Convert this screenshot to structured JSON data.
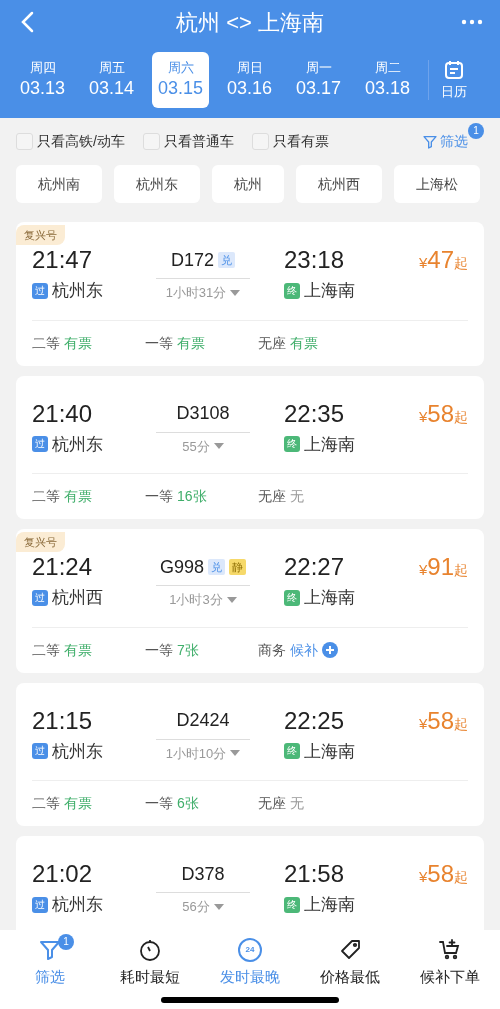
{
  "header": {
    "title": "杭州 <> 上海南"
  },
  "dates": [
    {
      "weekday": "周四",
      "date": "03.13",
      "selected": false
    },
    {
      "weekday": "周五",
      "date": "03.14",
      "selected": false
    },
    {
      "weekday": "周六",
      "date": "03.15",
      "selected": true
    },
    {
      "weekday": "周日",
      "date": "03.16",
      "selected": false
    },
    {
      "weekday": "周一",
      "date": "03.17",
      "selected": false
    },
    {
      "weekday": "周二",
      "date": "03.18",
      "selected": false
    }
  ],
  "calendar_label": "日历",
  "filters": [
    {
      "label": "只看高铁/动车",
      "checked": false
    },
    {
      "label": "只看普通车",
      "checked": false
    },
    {
      "label": "只看有票",
      "checked": false
    }
  ],
  "filter_button": {
    "label": "筛选",
    "badge": "1"
  },
  "stations": [
    "杭州南",
    "杭州东",
    "杭州",
    "杭州西",
    "上海松"
  ],
  "trains": [
    {
      "badge": "复兴号",
      "depart": "21:47",
      "train": "D172",
      "tags": [
        {
          "text": "兑",
          "kind": "blue"
        }
      ],
      "duration": "1小时31分",
      "arrive": "23:18",
      "from_tag": "过",
      "from": "杭州东",
      "to_tag": "终",
      "to": "上海南",
      "price_symbol": "¥",
      "price": "47",
      "price_suffix": "起",
      "seats": [
        {
          "class": "二等",
          "status": "有票",
          "kind": "available"
        },
        {
          "class": "一等",
          "status": "有票",
          "kind": "available"
        },
        {
          "class": "无座",
          "status": "有票",
          "kind": "available"
        }
      ]
    },
    {
      "depart": "21:40",
      "train": "D3108",
      "duration": "55分",
      "arrive": "22:35",
      "from_tag": "过",
      "from": "杭州东",
      "to_tag": "终",
      "to": "上海南",
      "price_symbol": "¥",
      "price": "58",
      "price_suffix": "起",
      "seats": [
        {
          "class": "二等",
          "status": "有票",
          "kind": "available"
        },
        {
          "class": "一等",
          "status": "16张",
          "kind": "available"
        },
        {
          "class": "无座",
          "status": "无",
          "kind": "none"
        }
      ]
    },
    {
      "badge": "复兴号",
      "depart": "21:24",
      "train": "G998",
      "tags": [
        {
          "text": "兑",
          "kind": "blue"
        },
        {
          "text": "静",
          "kind": "yellow"
        }
      ],
      "duration": "1小时3分",
      "arrive": "22:27",
      "from_tag": "过",
      "from": "杭州西",
      "to_tag": "终",
      "to": "上海南",
      "price_symbol": "¥",
      "price": "91",
      "price_suffix": "起",
      "seats": [
        {
          "class": "二等",
          "status": "有票",
          "kind": "available"
        },
        {
          "class": "一等",
          "status": "7张",
          "kind": "available"
        },
        {
          "class": "商务",
          "status": "候补",
          "kind": "waitlist"
        }
      ]
    },
    {
      "depart": "21:15",
      "train": "D2424",
      "duration": "1小时10分",
      "arrive": "22:25",
      "from_tag": "过",
      "from": "杭州东",
      "to_tag": "终",
      "to": "上海南",
      "price_symbol": "¥",
      "price": "58",
      "price_suffix": "起",
      "seats": [
        {
          "class": "二等",
          "status": "有票",
          "kind": "available"
        },
        {
          "class": "一等",
          "status": "6张",
          "kind": "available"
        },
        {
          "class": "无座",
          "status": "无",
          "kind": "none"
        }
      ]
    },
    {
      "depart": "21:02",
      "train": "D378",
      "duration": "56分",
      "arrive": "21:58",
      "from_tag": "过",
      "from": "杭州东",
      "to_tag": "终",
      "to": "上海南",
      "price_symbol": "¥",
      "price": "58",
      "price_suffix": "起"
    }
  ],
  "bottom_tabs": [
    {
      "label": "筛选",
      "kind": "filter",
      "badge": "1",
      "selected": true
    },
    {
      "label": "耗时最短",
      "kind": "timer",
      "selected": false
    },
    {
      "label": "发时最晚",
      "kind": "clock24",
      "icon_text": "24",
      "selected": true
    },
    {
      "label": "价格最低",
      "kind": "tag",
      "selected": false
    },
    {
      "label": "候补下单",
      "kind": "cart",
      "selected": false
    }
  ]
}
